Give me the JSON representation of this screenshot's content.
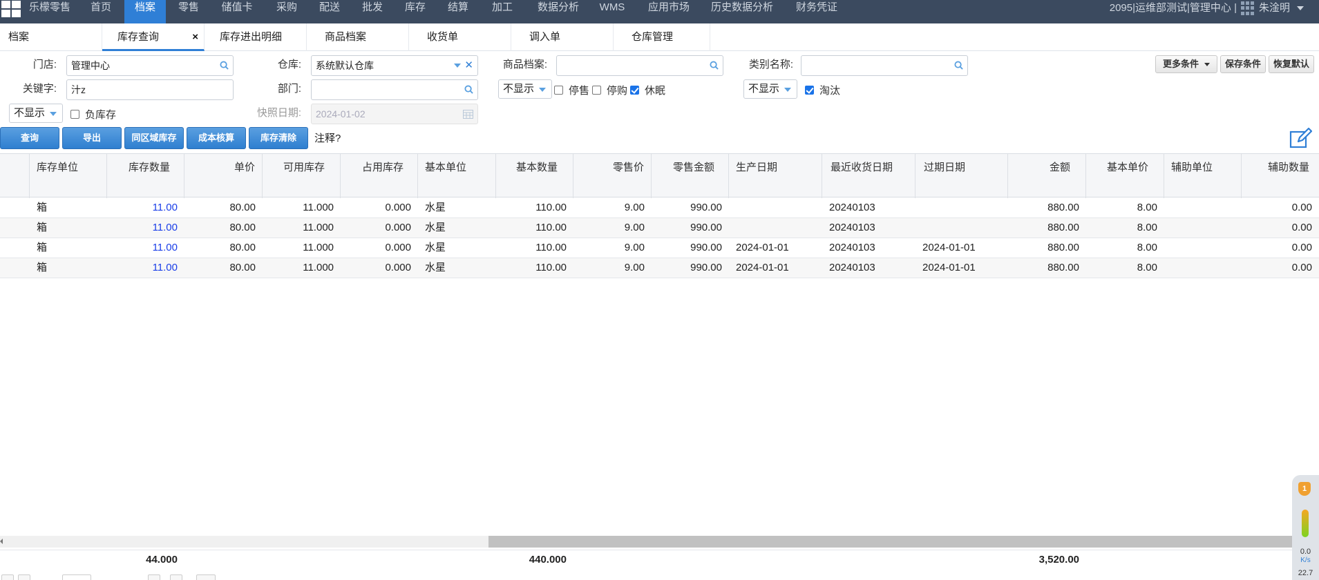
{
  "nav": {
    "brand": "乐檬零售",
    "items": [
      "首页",
      "档案",
      "零售",
      "储值卡",
      "采购",
      "配送",
      "批发",
      "库存",
      "结算",
      "加工",
      "数据分析",
      "WMS",
      "应用市场",
      "历史数据分析",
      "财务凭证"
    ],
    "active": "档案",
    "org": "2095|运维部测试|管理中心 |",
    "user": "朱淦明"
  },
  "tabs": [
    "档案",
    "库存查询",
    "库存进出明细",
    "商品档案",
    "收货单",
    "调入单",
    "仓库管理"
  ],
  "active_tab": "库存查询",
  "form": {
    "store_label": "门店:",
    "store_value": "管理中心",
    "warehouse_label": "仓库:",
    "warehouse_value": "系统默认仓库",
    "product_label": "商品档案:",
    "product_value": "",
    "category_label": "类别名称:",
    "category_value": "",
    "keyword_label": "关键字:",
    "keyword_value": "汁z",
    "dept_label": "部门:",
    "dept_value": "",
    "display_select_1": "不显示",
    "display_select_2": "不显示",
    "display_select_3": "不显示",
    "stop_sale_label": "停售",
    "stop_purchase_label": "停购",
    "dormant_label": "休眠",
    "eliminate_label": "淘汰",
    "negative_stock_label": "负库存",
    "snapshot_label": "快照日期:",
    "snapshot_value": "2024-01-02",
    "checks": {
      "stop_sale": false,
      "stop_purchase": false,
      "dormant": true,
      "eliminate": true,
      "negative_stock": false
    }
  },
  "buttons": {
    "more": "更多条件",
    "save": "保存条件",
    "reset": "恢复默认",
    "query": "查询",
    "export": "导出",
    "region": "同区域库存",
    "cost": "成本核算",
    "clear": "库存清除",
    "note": "注释?"
  },
  "table": {
    "columns": [
      "库存单位",
      "库存数量",
      "单价",
      "可用库存",
      "占用库存",
      "基本单位",
      "基本数量",
      "零售价",
      "零售金额",
      "生产日期",
      "最近收货日期",
      "过期日期",
      "金额",
      "基本单价",
      "辅助单位",
      "辅助数量"
    ],
    "rows": [
      [
        "箱",
        "11.00",
        "80.00",
        "11.000",
        "0.000",
        "水星",
        "110.00",
        "9.00",
        "990.00",
        "",
        "20240103",
        "",
        "880.00",
        "8.00",
        "",
        "0.00"
      ],
      [
        "箱",
        "11.00",
        "80.00",
        "11.000",
        "0.000",
        "水星",
        "110.00",
        "9.00",
        "990.00",
        "",
        "20240103",
        "",
        "880.00",
        "8.00",
        "",
        "0.00"
      ],
      [
        "箱",
        "11.00",
        "80.00",
        "11.000",
        "0.000",
        "水星",
        "110.00",
        "9.00",
        "990.00",
        "2024-01-01",
        "20240103",
        "2024-01-01",
        "880.00",
        "8.00",
        "",
        "0.00"
      ],
      [
        "箱",
        "11.00",
        "80.00",
        "11.000",
        "0.000",
        "水星",
        "110.00",
        "9.00",
        "990.00",
        "2024-01-01",
        "20240103",
        "2024-01-01",
        "880.00",
        "8.00",
        "",
        "0.00"
      ]
    ],
    "totals": {
      "stock_qty": "44.000",
      "base_qty": "440.000",
      "amount": "3,520.00"
    }
  },
  "widget": {
    "badge": "1",
    "speed": "0.0",
    "unit": "K/s",
    "extra": "22.7"
  },
  "colors": {
    "nav_bg": "#3b4a5f",
    "accent": "#2f7fd6",
    "qty_blue": "#1a3ee8"
  }
}
